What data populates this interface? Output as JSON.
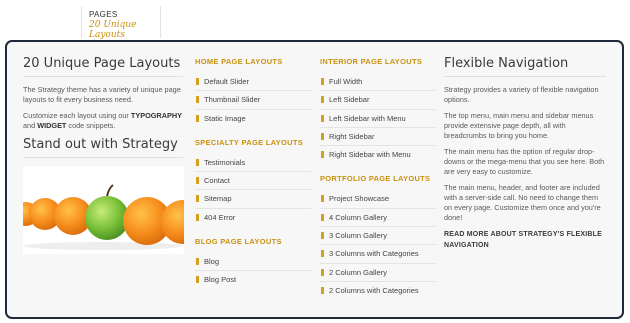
{
  "tab": {
    "title": "PAGES",
    "subtitle": "20 Unique Layouts"
  },
  "col1": {
    "heading": "20 Unique Page Layouts",
    "para1": "The Strategy theme has a variety of unique page layouts to fit every business need.",
    "para2_pre": "Customize each layout using our ",
    "para2_b1": "TYPOGRAPHY",
    "para2_mid": " and ",
    "para2_b2": "WIDGET",
    "para2_post": " code snippets.",
    "heading2": "Stand out with Strategy"
  },
  "home": {
    "title": "HOME PAGE LAYOUTS",
    "items": [
      "Default Slider",
      "Thumbnail Slider",
      "Static Image"
    ]
  },
  "specialty": {
    "title": "SPECIALTY PAGE LAYOUTS",
    "items": [
      "Testimonials",
      "Contact",
      "Sitemap",
      "404 Error"
    ]
  },
  "blog": {
    "title": "BLOG PAGE LAYOUTS",
    "items": [
      "Blog",
      "Blog Post"
    ]
  },
  "interior": {
    "title": "INTERIOR PAGE LAYOUTS",
    "items": [
      "Full Width",
      "Left Sidebar",
      "Left Sidebar with Menu",
      "Right Sidebar",
      "Right Sidebar with Menu"
    ]
  },
  "portfolio": {
    "title": "PORTFOLIO PAGE LAYOUTS",
    "items": [
      "Project Showcase",
      "4 Column Gallery",
      "3 Column Gallery",
      "3 Columns with Categories",
      "2 Column Gallery",
      "2 Columns with Categories"
    ]
  },
  "nav": {
    "heading": "Flexible Navigation",
    "p1": "Strategy provides a variety of flexible navigation options.",
    "p2": "The top menu, main menu and sidebar menus provide extensive page depth, all with breadcrumbs to bring you home.",
    "p3": "The main menu has the option of regular drop-downs or the mega-menu that you see here. Both are very easy to customize.",
    "p4": "The main menu, header, and footer are included with a server-side call. No need to change them on every page. Customize them once and you're done!",
    "readmore": "READ MORE ABOUT STRATEGY'S FLEXIBLE NAVIGATION"
  },
  "colors": {
    "accent": "#c9920e",
    "border": "#1f2a3a",
    "panel": "#f7f7f7"
  },
  "image": {
    "icon": "fruit-photo"
  }
}
